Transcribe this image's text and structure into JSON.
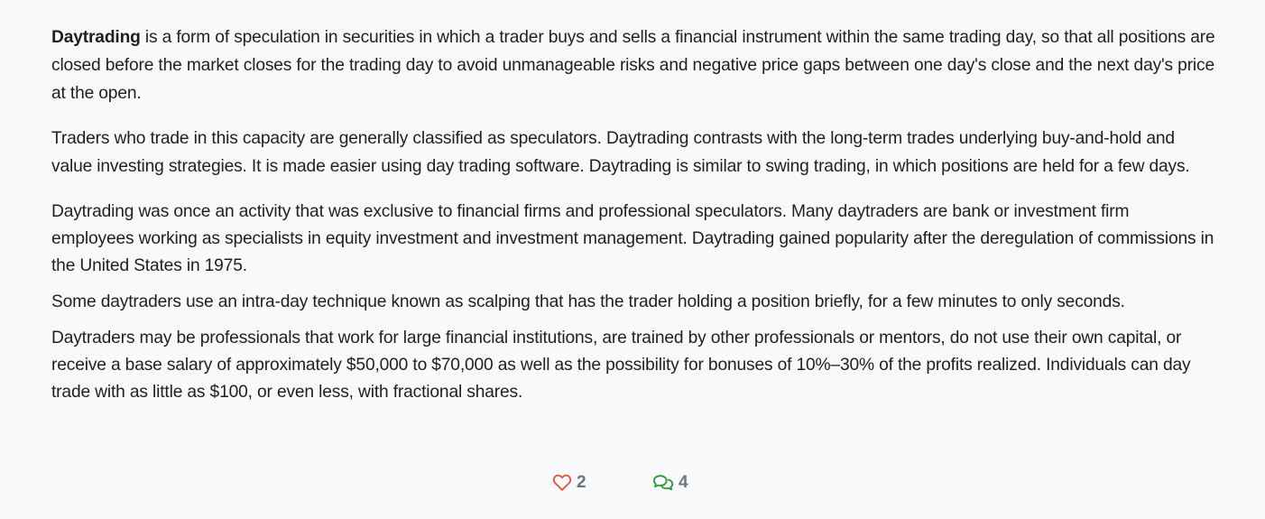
{
  "article": {
    "p1_term": "Daytrading",
    "p1_rest": " is a form of speculation in securities in which a trader buys and sells a financial instrument within the same trading day, so that all positions are closed before the market closes for the trading day to avoid unmanageable risks and negative price gaps between one day's close and the next day's price at the open.",
    "p2": "Traders who trade in this capacity are generally classified as speculators. Daytrading contrasts with the long-term trades underlying buy-and-hold and value investing strategies. It is made easier using day trading software. Daytrading is similar to swing trading, in which positions are held for a few days.",
    "p3": "Daytrading was once an activity that was exclusive to financial firms and professional speculators. Many daytraders are bank or investment firm employees working as specialists in equity investment and investment management. Daytrading gained popularity after the deregulation of commissions in the United States in 1975.",
    "p4": "Some daytraders use an intra-day technique known as scalping that has the trader holding a position briefly, for a few minutes to only seconds.",
    "p5": "Daytraders may be professionals that work for large financial institutions, are trained by other professionals or mentors, do not use their own capital, or receive a base salary of approximately $50,000 to $70,000 as well as the possibility for bonuses of 10%–30% of the profits realized. Individuals can day trade with as little as $100, or even less, with fractional shares."
  },
  "actions": {
    "likes": {
      "icon": "heart-icon",
      "count": "2",
      "color": "#e8573f"
    },
    "comments": {
      "icon": "comments-icon",
      "count": "4",
      "color": "#2e9a3a"
    }
  }
}
